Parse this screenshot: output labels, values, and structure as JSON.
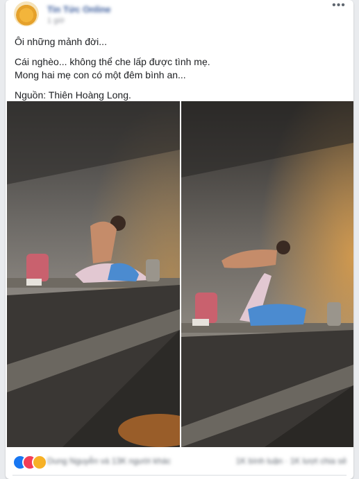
{
  "post": {
    "author_name": "Tin Tức Online",
    "timestamp": "1 giờ",
    "more_icon": "more-horizontal-icon",
    "lines": [
      "Ôi những mảnh đời...",
      "Cái nghèo... không thể che lấp được tình mẹ.",
      "Mong hai mẹ con có một đêm bình an...",
      "Nguồn: Thiên Hoàng Long."
    ]
  },
  "photos": [
    {
      "alt": "Người mẹ nằm trên vỉa hè chơi đùa với con"
    },
    {
      "alt": "Người mẹ nâng con lên trên vỉa hè ban đêm"
    }
  ],
  "reactions": {
    "icons": [
      "like-icon",
      "love-icon",
      "haha-icon"
    ],
    "colors": {
      "like": "#1877f2",
      "love": "#f33e58",
      "haha": "#f7b125"
    },
    "summary": "Dung Nguyễn và 13K người khác",
    "stats": "1K bình luận · 1K lượt chia sẻ"
  }
}
